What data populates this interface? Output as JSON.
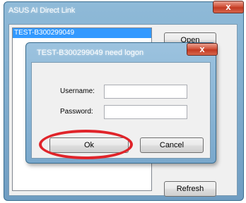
{
  "outer_window": {
    "title": "ASUS AI Direct Link",
    "close_glyph": "x",
    "device_list": [
      "TEST-B300299049"
    ],
    "open_button": "Open",
    "refresh_button": "Refresh"
  },
  "login_dialog": {
    "title": "TEST-B300299049 need logon",
    "close_glyph": "x",
    "username_label": "Username:",
    "username_value": "",
    "password_label": "Password:",
    "password_value": "",
    "ok_button": "Ok",
    "cancel_button": "Cancel"
  },
  "colors": {
    "titlebar": "#8fbad8",
    "selection": "#3399ff",
    "highlight_circle": "#e0242a",
    "close_button": "#c23a22"
  }
}
